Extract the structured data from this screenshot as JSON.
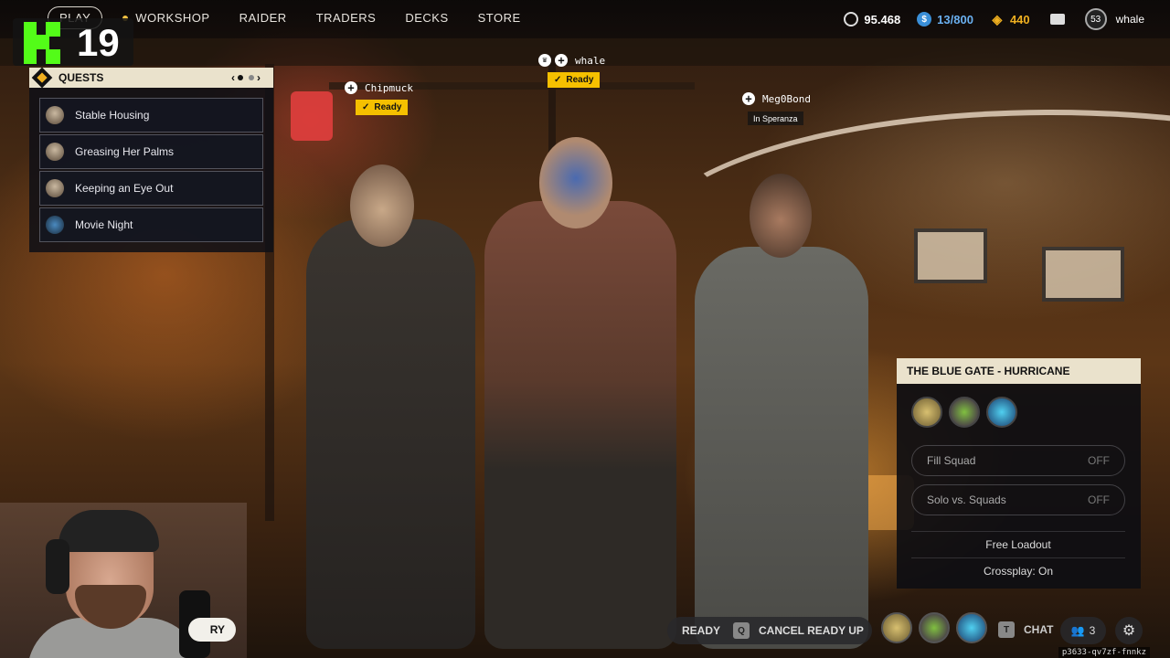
{
  "nav": {
    "play": "PLAY",
    "workshop": "WORKSHOP",
    "raider": "RAIDER",
    "traders": "TRADERS",
    "decks": "DECKS",
    "store": "STORE"
  },
  "stats": {
    "coins": "95.468",
    "credits": "13/800",
    "raider_tokens": "440",
    "level": "53",
    "username": "whale"
  },
  "stream": {
    "viewers": "19"
  },
  "quests": {
    "title": "QUESTS",
    "items": [
      {
        "label": "Stable Housing"
      },
      {
        "label": "Greasing Her Palms"
      },
      {
        "label": "Keeping an Eye Out"
      },
      {
        "label": "Movie Night"
      }
    ]
  },
  "players": {
    "left": {
      "name": "Chipmuck",
      "status": "Ready"
    },
    "center": {
      "name": "whale",
      "status": "Ready"
    },
    "right": {
      "name": "Meg0Bond",
      "status": "In Speranza"
    }
  },
  "squad": {
    "title": "THE BLUE GATE - HURRICANE",
    "fill_squad": {
      "label": "Fill Squad",
      "value": "OFF"
    },
    "solo_vs_squads": {
      "label": "Solo vs. Squads",
      "value": "OFF"
    },
    "free_loadout": "Free Loadout",
    "crossplay": "Crossplay: On"
  },
  "bottom": {
    "ready": "READY",
    "cancel_key": "Q",
    "cancel_label": "CANCEL READY UP",
    "chat_key": "T",
    "chat_label": "CHAT",
    "party_count": "3",
    "story_label": "RY",
    "session_id": "p3633-qv7zf-fnnkz"
  },
  "colors": {
    "accent_yellow": "#f5c000",
    "panel_header": "#eae2cc",
    "kick_green": "#53fc18"
  }
}
